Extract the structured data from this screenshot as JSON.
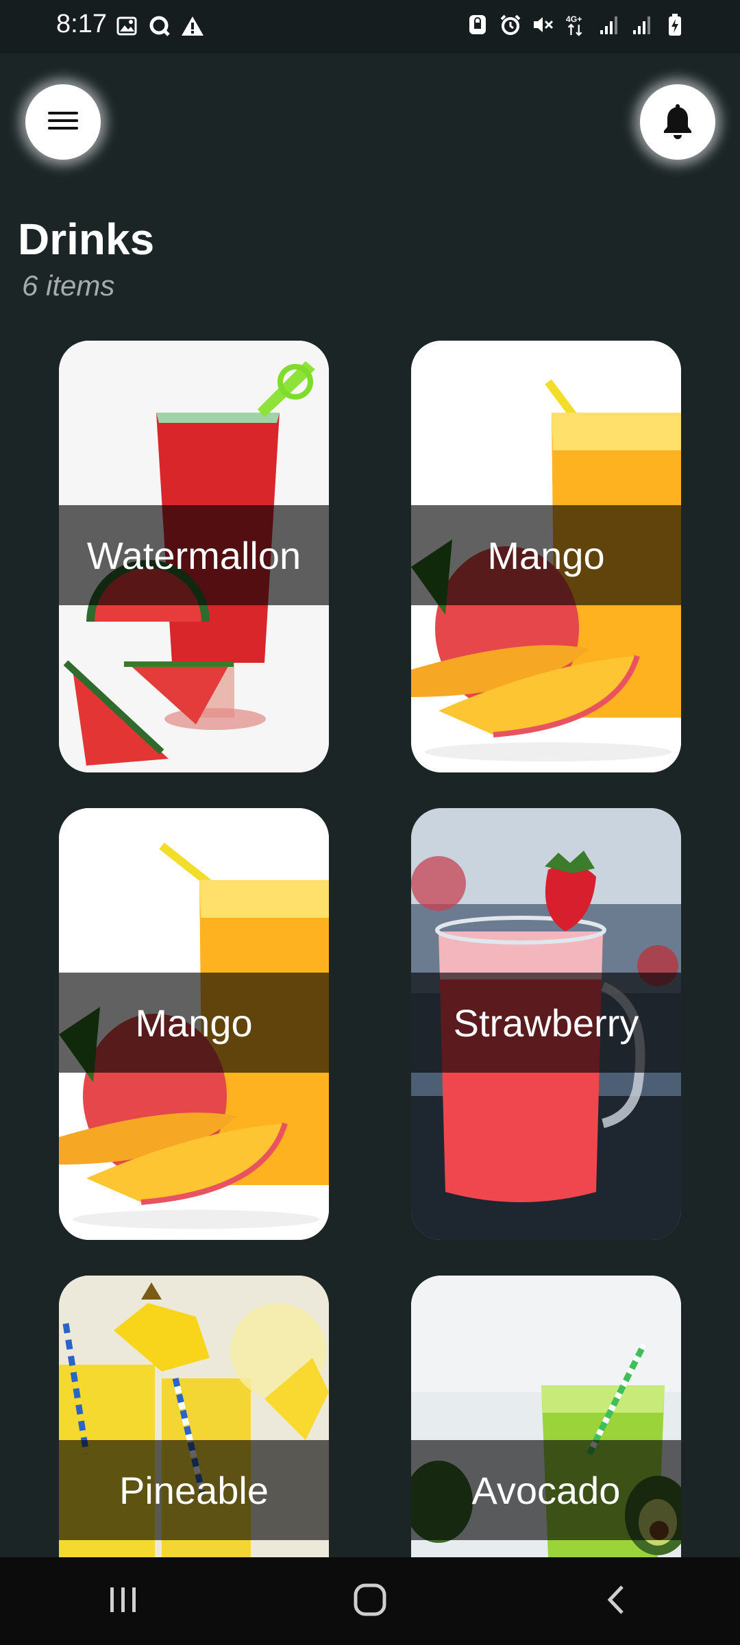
{
  "status_bar": {
    "time": "8:17",
    "left_icons": [
      "image-icon",
      "search-q-icon",
      "warning-icon"
    ],
    "right_icons": [
      "lock-sync-icon",
      "alarm-icon",
      "mute-icon",
      "4g-data-icon",
      "signal-1-icon",
      "signal-2-icon",
      "battery-charging-icon"
    ],
    "network_label": "4G+"
  },
  "header": {
    "title": "Drinks",
    "subtitle": "6 items"
  },
  "drinks": [
    {
      "name": "Watermallon"
    },
    {
      "name": "Mango"
    },
    {
      "name": "Mango"
    },
    {
      "name": "Strawberry"
    },
    {
      "name": "Pineable"
    },
    {
      "name": "Avocado"
    }
  ],
  "colors": {
    "background": "#1b2526",
    "status_bar": "#161d1e",
    "nav_bar": "#0c0c0c",
    "text": "#ffffff",
    "subtitle": "#a4acad"
  }
}
